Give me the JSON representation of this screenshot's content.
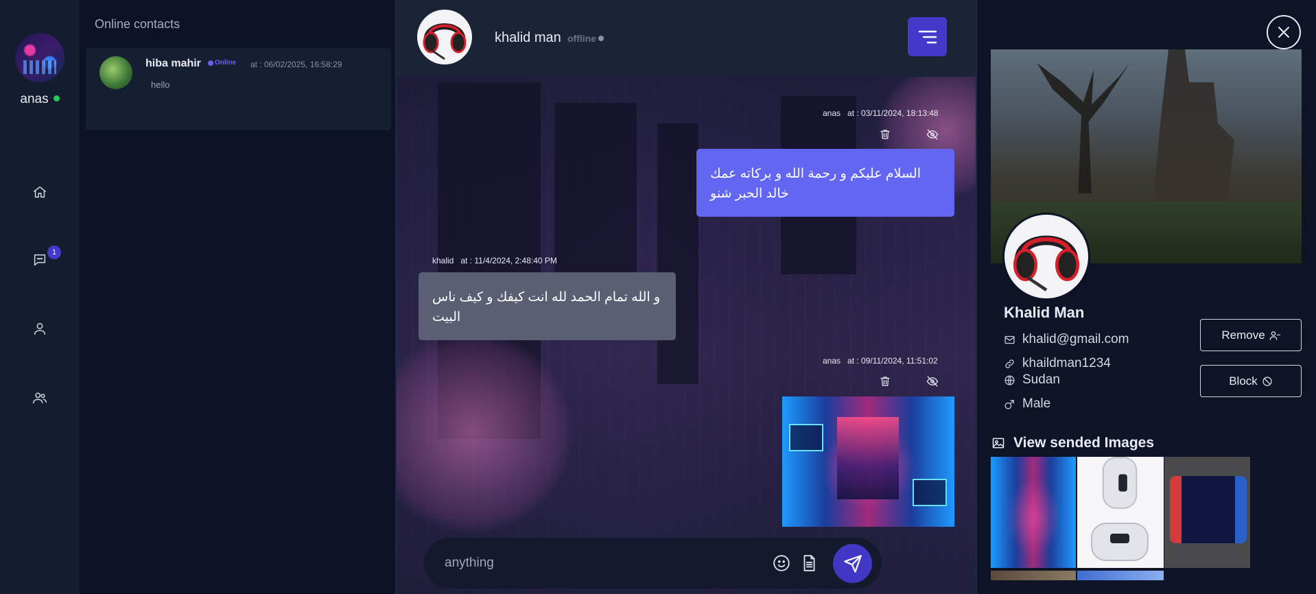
{
  "user": {
    "name": "anas",
    "status_color": "#22c55e"
  },
  "nav": {
    "messages_badge": "1"
  },
  "contacts": {
    "title": "Online contacts",
    "items": [
      {
        "name": "hiba mahir",
        "status": "Online",
        "time": "at : 06/02/2025, 16:58:29",
        "last_message": "hello"
      }
    ]
  },
  "chat": {
    "header": {
      "name": "khalid man",
      "status": "offline"
    },
    "messages": [
      {
        "sender": "anas",
        "time": "at : 03/11/2024, 18:13:48",
        "text": "السلام عليكم و رحمة الله و بركاته عمك خالد الحبر شنو",
        "direction": "out"
      },
      {
        "sender": "khalid",
        "time": "at : 11/4/2024, 2:48:40 PM",
        "text": "و الله تمام الحمد لله انت كيفك و كيف ناس البيت",
        "direction": "in"
      },
      {
        "sender": "anas",
        "time": "at : 09/11/2024, 11:51:02",
        "type": "image",
        "direction": "out"
      }
    ],
    "composer": {
      "placeholder": "anything"
    }
  },
  "profile": {
    "name": "Khalid Man",
    "email": "khalid@gmail.com",
    "username": "khaildman1234",
    "country": "Sudan",
    "gender": "Male",
    "remove_label": "Remove",
    "block_label": "Block",
    "gallery_title": "View sended Images"
  },
  "colors": {
    "accent": "#4338ca",
    "outgoing_bubble": "#6366f1",
    "incoming_bubble": "#5a5f73",
    "online": "#22c55e"
  }
}
